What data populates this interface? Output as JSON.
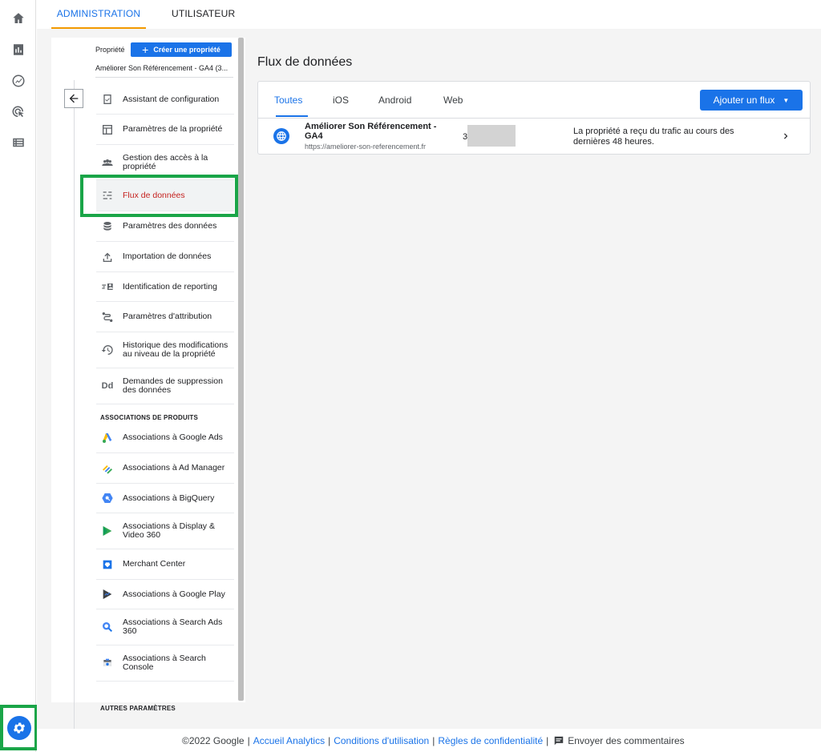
{
  "top_tabs": [
    "ADMINISTRATION",
    "UTILISATEUR"
  ],
  "property": {
    "label": "Propriété",
    "create_label": "Créer une propriété",
    "name": "Améliorer Son Référencement  - GA4 (3..."
  },
  "menu": {
    "items": [
      {
        "label": "Assistant de configuration",
        "icon": "checklist-icon"
      },
      {
        "label": "Paramètres de la propriété",
        "icon": "layout-icon"
      },
      {
        "label": "Gestion des accès à la propriété",
        "icon": "people-icon"
      },
      {
        "label": "Flux de données",
        "icon": "data-stream-icon",
        "active": true
      },
      {
        "label": "Paramètres des données",
        "icon": "database-icon"
      },
      {
        "label": "Importation de données",
        "icon": "upload-icon"
      },
      {
        "label": "Identification de reporting",
        "icon": "identity-icon"
      },
      {
        "label": "Paramètres d'attribution",
        "icon": "route-icon"
      },
      {
        "label": "Historique des modifications au niveau de la propriété",
        "icon": "history-icon"
      },
      {
        "label": "Demandes de suppression des données",
        "icon": "dd-icon",
        "glyph": "Dd"
      }
    ],
    "section_products": "ASSOCIATIONS DE PRODUITS",
    "products": [
      {
        "label": "Associations à Google Ads",
        "icon": "google-ads-icon"
      },
      {
        "label": "Associations à Ad Manager",
        "icon": "ad-manager-icon"
      },
      {
        "label": "Associations à BigQuery",
        "icon": "bigquery-icon"
      },
      {
        "label": "Associations à Display & Video 360",
        "icon": "display-video-icon"
      },
      {
        "label": "Merchant Center",
        "icon": "merchant-center-icon"
      },
      {
        "label": "Associations à Google Play",
        "icon": "google-play-icon"
      },
      {
        "label": "Associations à Search Ads 360",
        "icon": "search-ads-icon"
      },
      {
        "label": "Associations à Search Console",
        "icon": "search-console-icon"
      }
    ],
    "section_other": "AUTRES PARAMÈTRES"
  },
  "content": {
    "title": "Flux de données",
    "tabs": [
      "Toutes",
      "iOS",
      "Android",
      "Web"
    ],
    "add_button": "Ajouter un flux",
    "stream": {
      "name": "Améliorer Son Référencement  - GA4",
      "url": "https://ameliorer-son-referencement.fr",
      "id": "3",
      "status": "La propriété a reçu du trafic au cours des dernières 48 heures."
    }
  },
  "footer": {
    "copyright": "©2022 Google",
    "links": [
      "Accueil Analytics",
      "Conditions d'utilisation",
      "Règles de confidentialité"
    ],
    "feedback": "Envoyer des commentaires"
  },
  "colors": {
    "accent": "#1a73e8",
    "active_text": "#c5221f",
    "highlight_frame": "#1aa548",
    "tab_underline": "#f29900"
  }
}
